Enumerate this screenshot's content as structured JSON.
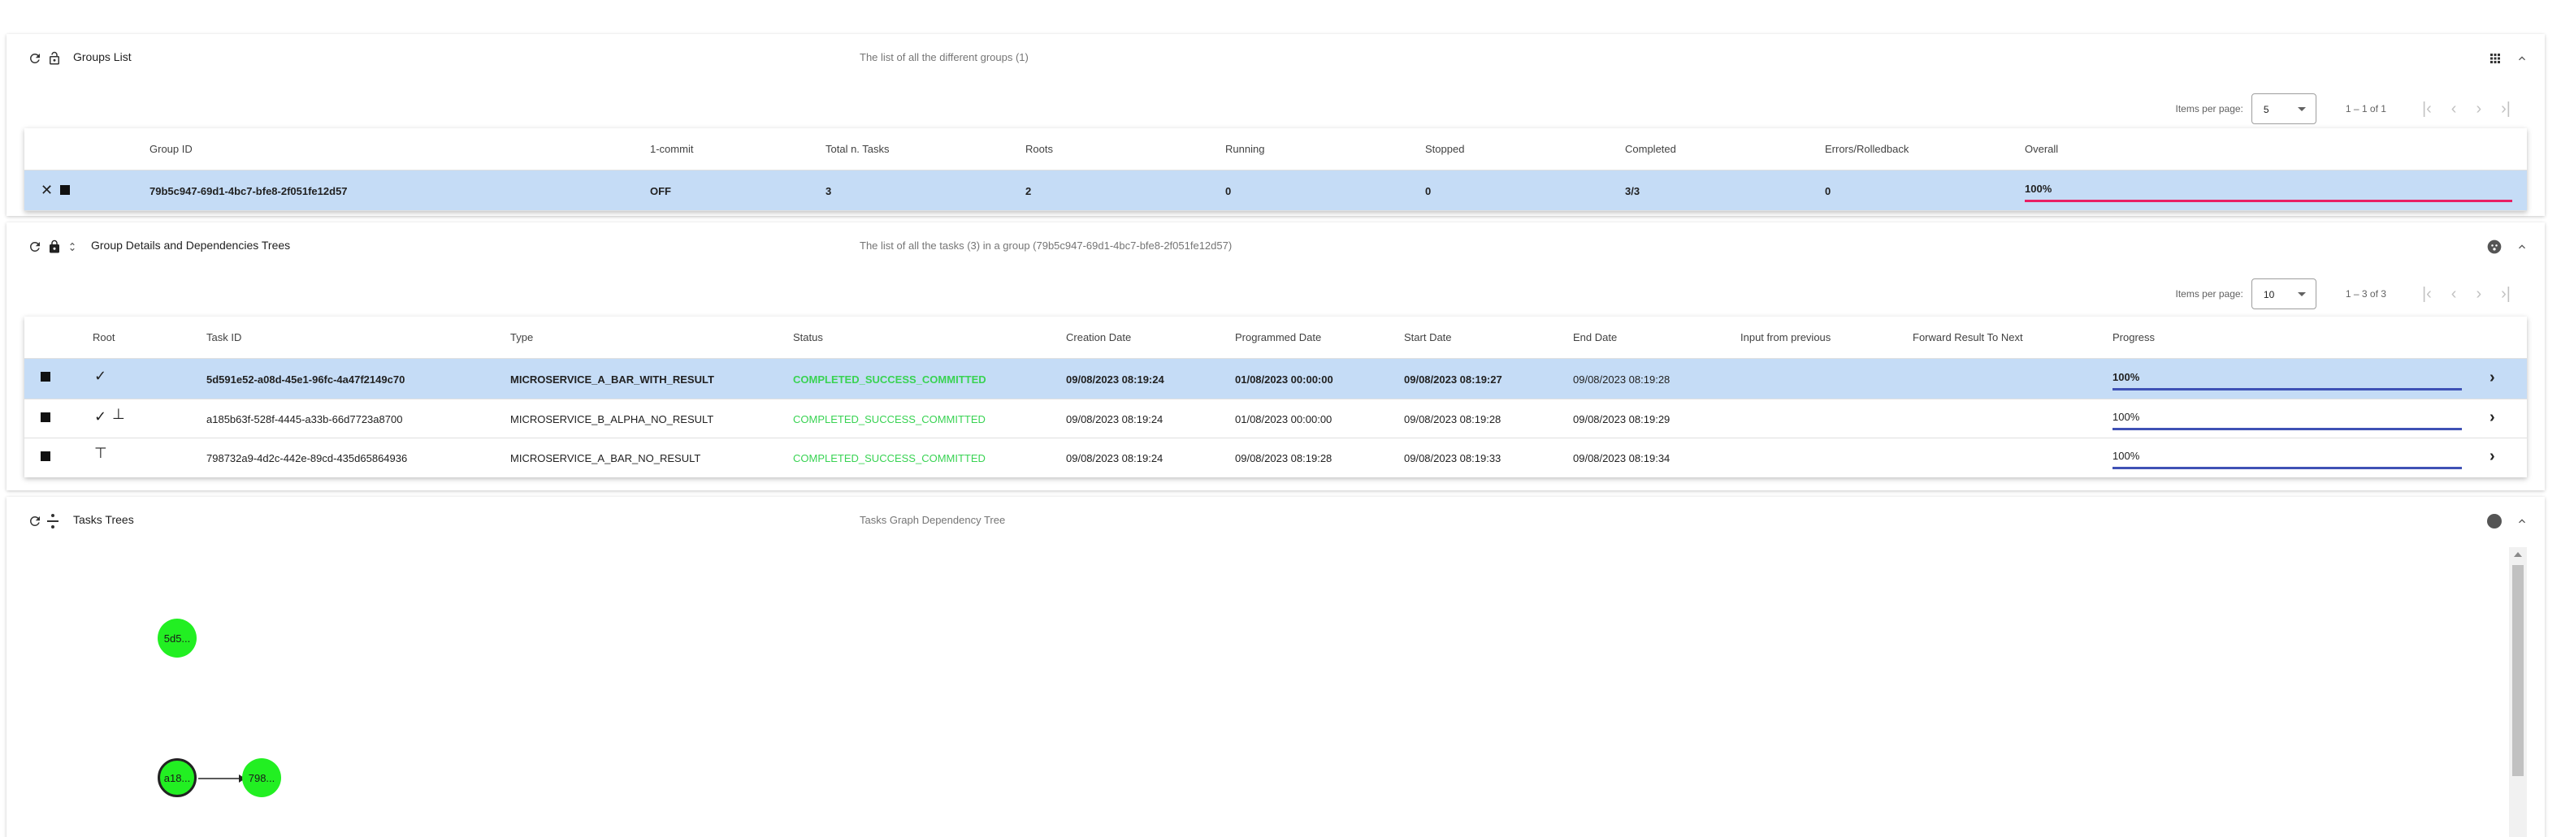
{
  "groups_panel": {
    "title": "Groups List",
    "subtitle": "The list of all the different groups (1)",
    "pager": {
      "items_per_page_label": "Items per page:",
      "items_per_page": "5",
      "range": "1 – 1 of 1"
    },
    "columns": [
      "Group ID",
      "1-commit",
      "Total n. Tasks",
      "Roots",
      "Running",
      "Stopped",
      "Completed",
      "Errors/Rolledback",
      "Overall"
    ],
    "rows": [
      {
        "group_id": "79b5c947-69d1-4bc7-bfe8-2f051fe12d57",
        "one_commit": "OFF",
        "total_tasks": "3",
        "roots": "2",
        "running": "0",
        "stopped": "0",
        "completed": "3/3",
        "errors": "0",
        "overall": "100%",
        "overall_fraction": 1.0
      }
    ]
  },
  "details_panel": {
    "title": "Group Details and Dependencies Trees",
    "subtitle": "The list of all the tasks (3) in a group (79b5c947-69d1-4bc7-bfe8-2f051fe12d57)",
    "pager": {
      "items_per_page_label": "Items per page:",
      "items_per_page": "10",
      "range": "1 – 3 of 3"
    },
    "columns": [
      "Root",
      "Task ID",
      "Type",
      "Status",
      "Creation Date",
      "Programmed Date",
      "Start Date",
      "End Date",
      "Input from previous",
      "Forward Result To Next",
      "Progress"
    ],
    "rows": [
      {
        "task_id": "5d591e52-a08d-45e1-96fc-4a47f2149c70",
        "type": "MICROSERVICE_A_BAR_WITH_RESULT",
        "status": "COMPLETED_SUCCESS_COMMITTED",
        "creation_date": "09/08/2023 08:19:24",
        "programmed_date": "01/08/2023 00:00:00",
        "start_date": "09/08/2023 08:19:27",
        "end_date": "09/08/2023 08:19:28",
        "progress": "100%",
        "progress_fraction": 1.0
      },
      {
        "task_id": "a185b63f-528f-4445-a33b-66d7723a8700",
        "type": "MICROSERVICE_B_ALPHA_NO_RESULT",
        "status": "COMPLETED_SUCCESS_COMMITTED",
        "creation_date": "09/08/2023 08:19:24",
        "programmed_date": "01/08/2023 00:00:00",
        "start_date": "09/08/2023 08:19:28",
        "end_date": "09/08/2023 08:19:29",
        "progress": "100%",
        "progress_fraction": 1.0
      },
      {
        "task_id": "798732a9-4d2c-442e-89cd-435d65864936",
        "type": "MICROSERVICE_A_BAR_NO_RESULT",
        "status": "COMPLETED_SUCCESS_COMMITTED",
        "creation_date": "09/08/2023 08:19:24",
        "programmed_date": "09/08/2023 08:19:28",
        "start_date": "09/08/2023 08:19:33",
        "end_date": "09/08/2023 08:19:34",
        "progress": "100%",
        "progress_fraction": 1.0
      }
    ]
  },
  "tree_panel": {
    "title": "Tasks Trees",
    "subtitle": "Tasks Graph Dependency Tree",
    "nodes": [
      {
        "label": "5d5..."
      },
      {
        "label": "a18..."
      },
      {
        "label": "798..."
      }
    ]
  },
  "colors": {
    "selected_row": "#c5dcf6",
    "status_success": "#39d353",
    "overall_bar": "#e91e63",
    "progress_bar": "#3f51b5",
    "node_fill": "#22ef22"
  }
}
